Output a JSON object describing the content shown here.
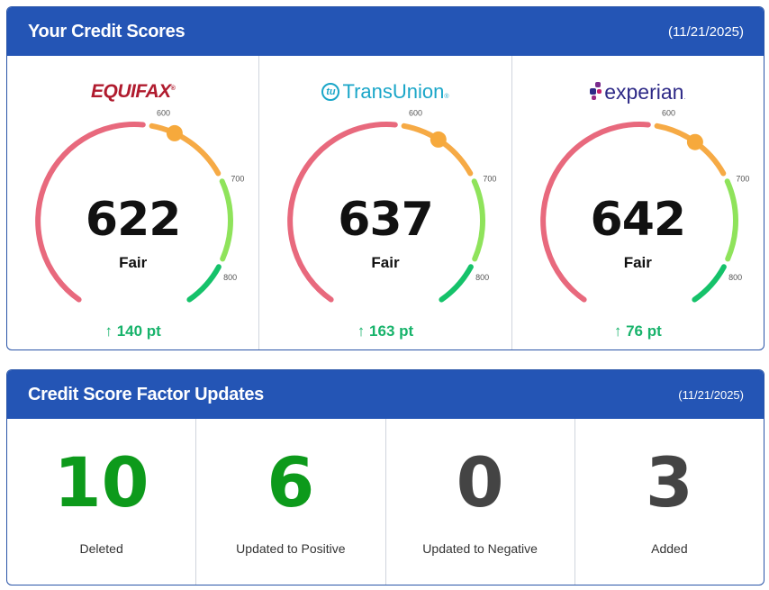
{
  "scores_card": {
    "title": "Your Credit Scores",
    "date": "(11/21/2025)",
    "tick_labels": [
      "600",
      "700",
      "800"
    ],
    "bureaus": [
      {
        "name": "EQUIFAX",
        "score": "622",
        "rating": "Fair",
        "change": "140 pt",
        "score_value": 622
      },
      {
        "name": "TransUnion",
        "score": "637",
        "rating": "Fair",
        "change": "163 pt",
        "score_value": 637
      },
      {
        "name": "experian",
        "score": "642",
        "rating": "Fair",
        "change": "76 pt",
        "score_value": 642
      }
    ],
    "gauge_colors": {
      "red": "#e8697d",
      "orange": "#f6aa45",
      "lightgreen": "#8fe35b",
      "green": "#15c26a",
      "marker": "#f6a93c"
    }
  },
  "factors_card": {
    "title": "Credit Score Factor Updates",
    "date": "(11/21/2025)",
    "items": [
      {
        "value": "10",
        "label": "Deleted",
        "color": "#0d9a1b"
      },
      {
        "value": "6",
        "label": "Updated to Positive",
        "color": "#0d9a1b"
      },
      {
        "value": "0",
        "label": "Updated to Negative",
        "color": "#444444"
      },
      {
        "value": "3",
        "label": "Added",
        "color": "#444444"
      }
    ]
  },
  "icons": {
    "change_up": "arrow-up-icon"
  }
}
